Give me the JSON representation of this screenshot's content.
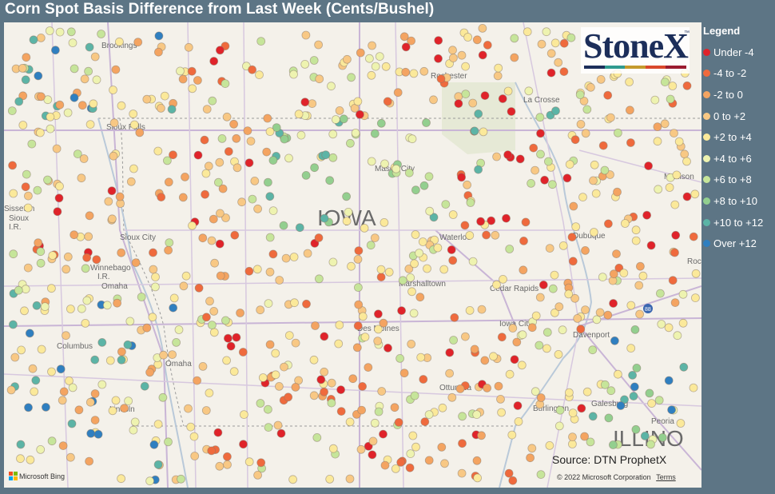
{
  "title": "Corn Spot Basis Difference from Last Week (Cents/Bushel)",
  "legend": {
    "title": "Legend",
    "items": [
      {
        "label": "Under -4",
        "color": "#e0232a"
      },
      {
        "label": "-4 to -2",
        "color": "#ef6a3d"
      },
      {
        "label": "-2 to 0",
        "color": "#f4a461"
      },
      {
        "label": "0 to +2",
        "color": "#f8c884"
      },
      {
        "label": "+2 to +4",
        "color": "#fbe99a"
      },
      {
        "label": "+4 to +6",
        "color": "#eef3b0"
      },
      {
        "label": "+6 to +8",
        "color": "#c6e59a"
      },
      {
        "label": "+8 to +10",
        "color": "#93cf8f"
      },
      {
        "label": "+10 to +12",
        "color": "#5cb4a6"
      },
      {
        "label": "Over +12",
        "color": "#2f7fc0"
      }
    ]
  },
  "logo": {
    "text": "StoneX",
    "tm": "™",
    "bar_colors": [
      "#1c2e5a",
      "#2f9a8f",
      "#c49a2c",
      "#d9482b",
      "#9b1b30"
    ]
  },
  "source": "Source: DTN ProphetX",
  "copyright": "© 2022 Microsoft Corporation",
  "terms": "Terms",
  "bing": "Microsoft Bing",
  "map": {
    "state_label": "IOWA",
    "state_label_2": "ILLINO",
    "places": [
      "Brookings",
      "Rochester",
      "La Crosse",
      "Sioux Falls",
      "Mason City",
      "Madison",
      "Sisseton",
      "Sioux",
      "I.R.",
      "Sioux City",
      "Waterloo",
      "Dubuque",
      "Rockford",
      "Winnebago",
      "I.R.",
      "Omaha",
      "Marshalltown",
      "Cedar Rapids",
      "Iowa City",
      "Columbus",
      "Des Moines",
      "Davenport",
      "Omaha",
      "Ottumwa",
      "Galesburg",
      "Lincoln",
      "Burlington",
      "Peoria"
    ],
    "highway": "88"
  }
}
